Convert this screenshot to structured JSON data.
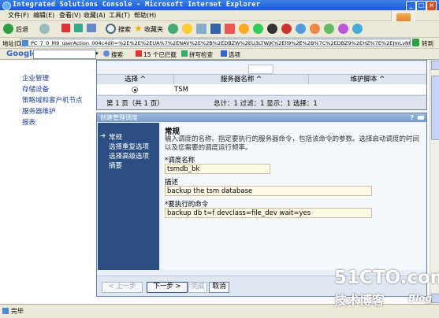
{
  "window": {
    "title": "Integrated Solutions Console - Microsoft Internet Explorer"
  },
  "menu": {
    "items": [
      "文件(F)",
      "编辑(E)",
      "查看(V)",
      "收藏(A)",
      "工具(T)",
      "帮助(H)"
    ]
  },
  "toolbar": {
    "back_label": "后退",
    "search_label": "搜索",
    "favorites_label": "收藏夹"
  },
  "address": {
    "label": "地址(D)",
    "url": "PC_7_0_M9_userAction_004c4d0=%2E%2E%2EUA%7%2ENAV%2E%2B%2EDBZW%2EU3LTWjK%2Ell9%2E%2B%7C%2EDBZ9%2EHZ%7E%2EJmLvNtRvt%2Ellta%2B",
    "go_label": "转到"
  },
  "googlebar": {
    "brand": "Google",
    "search_label": "搜索",
    "blocked_label": "15 个已拦截",
    "spell_label": "拼写检查",
    "options_label": "选项"
  },
  "sidebar": {
    "items": [
      "企业管理",
      "存储设备",
      "策略域和客户机节点",
      "服务器维护",
      "报表"
    ]
  },
  "table": {
    "col_select": "选择 ^",
    "col_server": "服务器名称 ^",
    "col_script": "维护脚本 ^",
    "row_server": "TSM",
    "page_label": "第 1 页（共 1 页）",
    "summary": "总计：1  过滤：1  显示：1  选择：1"
  },
  "wizard": {
    "title": "创建管理调度",
    "help": "?",
    "steps": [
      "常规",
      "选择重复选项",
      "选择高级选项",
      "摘要"
    ],
    "active_step_marker": "➔",
    "heading": "常规",
    "description": "输入调度的名称。指定要执行的服务器命令，包括该命令的参数。选择启动调度的时间以及您需要的调度运行频率。",
    "name_label": "*调度名称",
    "name_value": "tsmdb_bk",
    "desc_label": "描述",
    "desc_value": "backup the tsm database",
    "cmd_label": "*要执行的命令",
    "cmd_value": "backup db t=f devclass=file_dev wait=yes",
    "buttons": {
      "prev": "< 上一步",
      "next": "下一步 >",
      "finish": "完成",
      "cancel": "取消"
    }
  },
  "status": {
    "text": "完毕"
  },
  "watermark": {
    "site": "51CTO.com",
    "blog": "技术博客",
    "blog_en": "Blog"
  }
}
